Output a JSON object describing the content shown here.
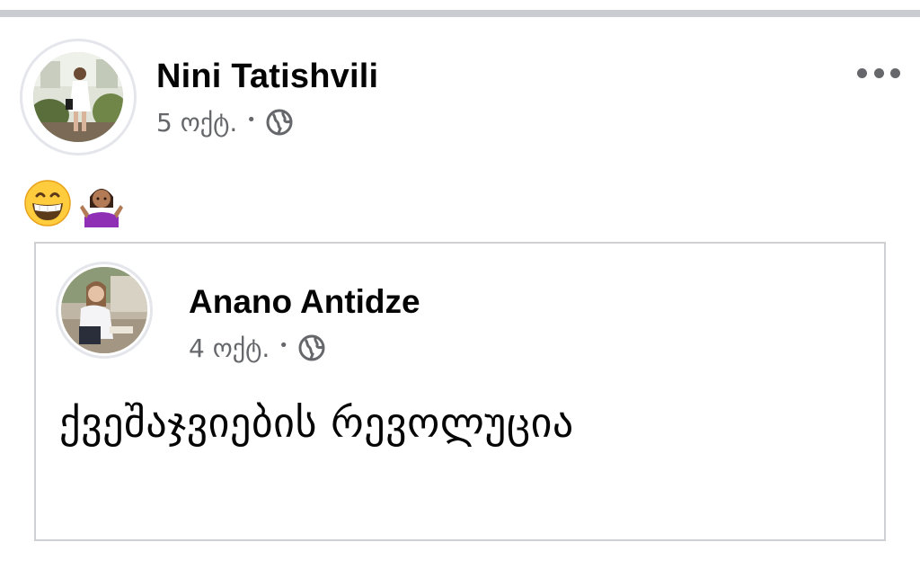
{
  "post": {
    "author": "Nini Tatishvili",
    "date": "5 ოქტ.",
    "separator": "•",
    "audience_icon": "globe-icon",
    "more_icon": "more-options-icon",
    "emojis": [
      "😁",
      "🤷🏽‍♀️"
    ]
  },
  "shared_post": {
    "author": "Anano Antidze",
    "date": "4 ოქტ.",
    "separator": "•",
    "audience_icon": "globe-icon",
    "text": "ქვეშაჯვიების რევოლუცია"
  },
  "colors": {
    "meta_gray": "#65676b",
    "text": "#050505",
    "border": "#ced0d4"
  }
}
